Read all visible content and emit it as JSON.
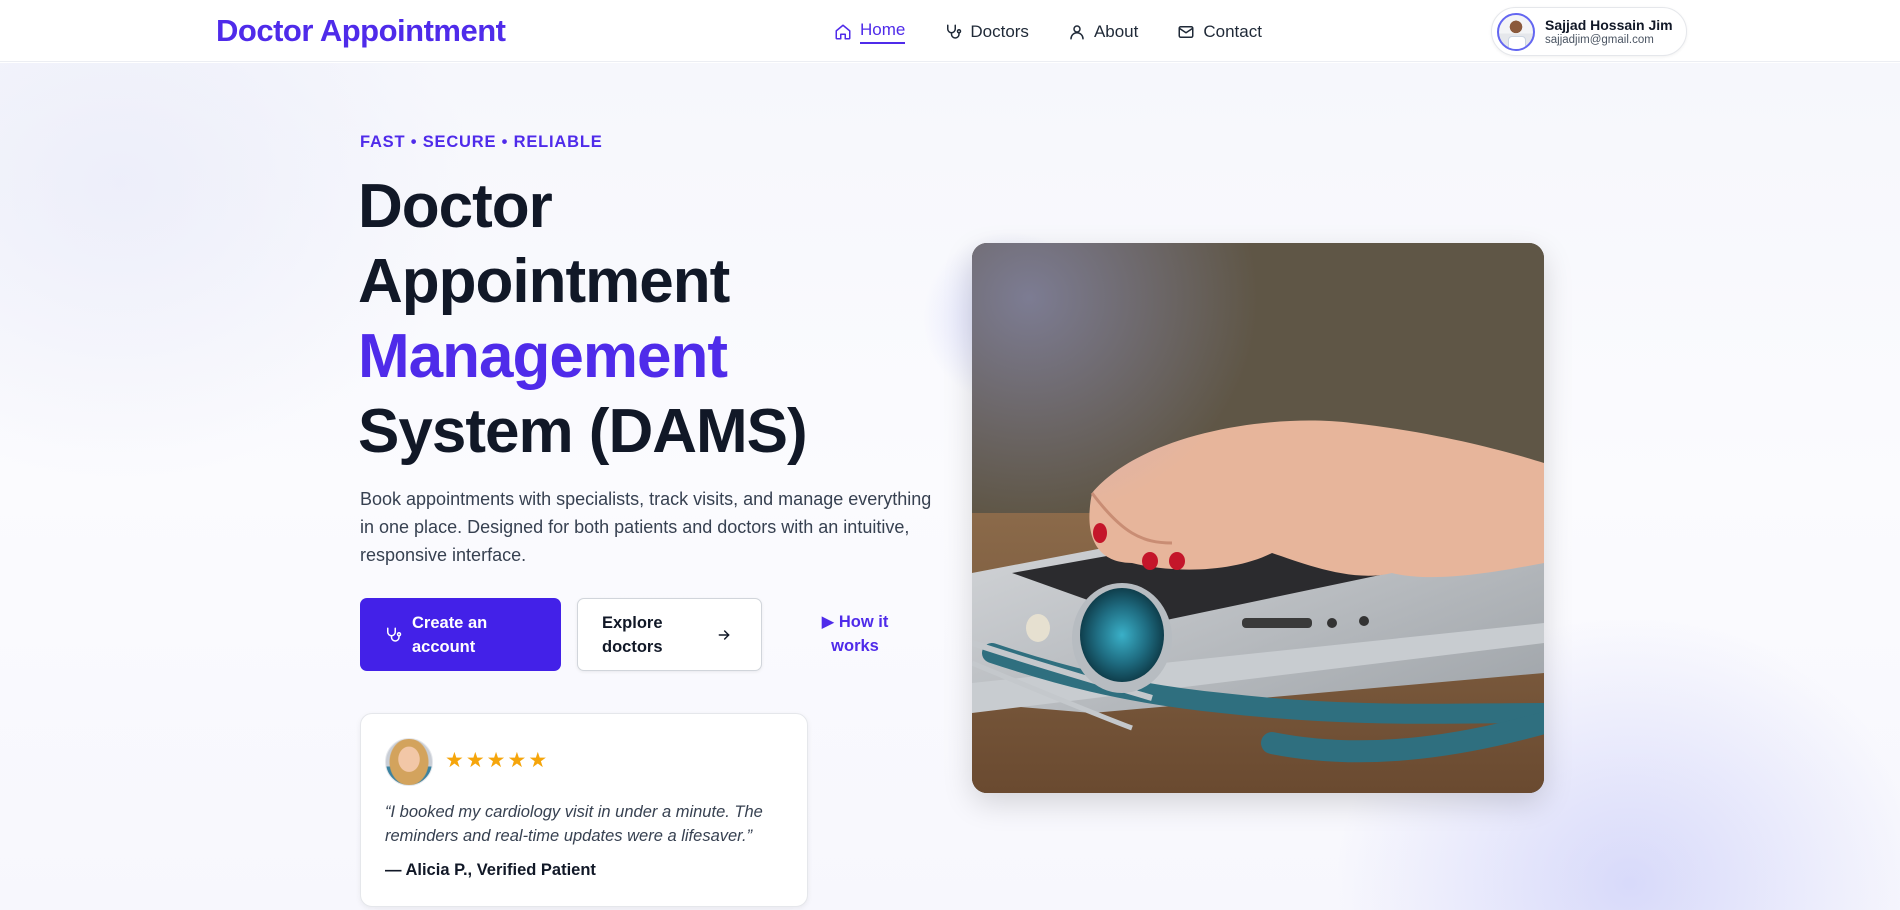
{
  "brand": "Doctor Appointment",
  "nav": {
    "items": [
      {
        "label": "Home",
        "icon": "home-icon",
        "active": true
      },
      {
        "label": "Doctors",
        "icon": "stethoscope-icon",
        "active": false
      },
      {
        "label": "About",
        "icon": "user-icon",
        "active": false
      },
      {
        "label": "Contact",
        "icon": "mail-icon",
        "active": false
      }
    ]
  },
  "user": {
    "name": "Sajjad Hossain Jim",
    "email": "sajjadjim@gmail.com"
  },
  "hero": {
    "tagline": "FAST • SECURE • RELIABLE",
    "title_line1": "Doctor",
    "title_line2": "Appointment",
    "title_accent": "Management",
    "title_line4": "System (DAMS)",
    "description": "Book appointments with specialists, track visits, and manage everything in one place. Designed for both patients and doctors with an intuitive, responsive interface.",
    "primary_button": "Create an account",
    "secondary_button": "Explore doctors",
    "link_button": "▶ How it works"
  },
  "testimonial": {
    "rating": 5,
    "stars": "★★★★★",
    "quote": "“I booked my cardiology visit in under a minute. The reminders and real-time updates were a lifesaver.”",
    "author": "— Alicia P., Verified Patient"
  },
  "colors": {
    "accent": "#4f2bea",
    "primary_button": "#4321e8",
    "star": "#f5a50b"
  }
}
